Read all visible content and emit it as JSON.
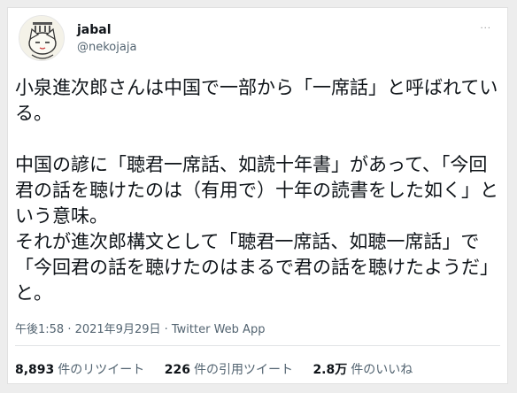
{
  "user": {
    "display_name": "jabal",
    "handle": "@nekojaja"
  },
  "tweet": {
    "text": "小泉進次郎さんは中国で一部から「一席話」と呼ばれている。\n\n中国の諺に「聴君一席話、如読十年書」があって、「今回君の話を聴けたのは（有用で）十年の読書をした如く」という意味。\nそれが進次郎構文として「聴君一席話、如聴一席話」で「今回君の話を聴けたのはまるで君の話を聴けたようだ」と。",
    "timestamp": "午後1:58 · 2021年9月29日 · Twitter Web App"
  },
  "stats": {
    "retweets_count": "8,893",
    "retweets_label": "件のリツイート",
    "quotes_count": "226",
    "quotes_label": "件の引用ツイート",
    "likes_count": "2.8万",
    "likes_label": "件のいいね"
  },
  "icons": {
    "avatar": "cat-avatar",
    "more": "more-dots-icon"
  }
}
